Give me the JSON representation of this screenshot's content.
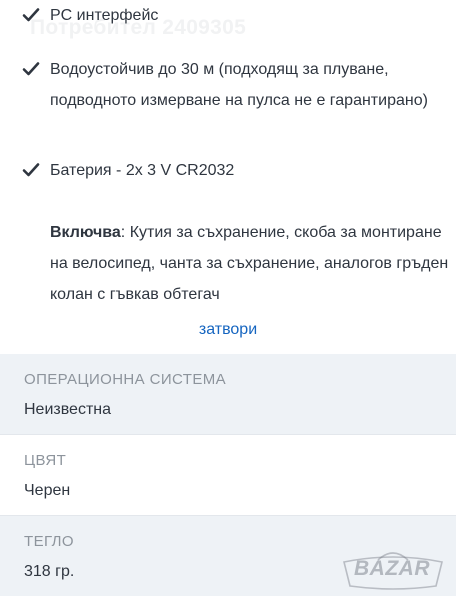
{
  "watermark": "Потребител 2409305",
  "features": [
    {
      "text": "PC интерфейс"
    },
    {
      "text": "Водоустойчив до 30 м (подходящ за плуване, подводното измерване на пулса не е гарантирано)"
    },
    {
      "text": "Батерия - 2x 3 V CR2032"
    }
  ],
  "includes": {
    "label": "Включва",
    "text": ": Кутия за съхранение, скоба за монтиране на велосипед, чанта за съхранение, аналогов гръден колан с гъвкав обтегач"
  },
  "close_link": "затвори",
  "specs": [
    {
      "label": "ОПЕРАЦИОННА СИСТЕМА",
      "value": "Неизвестна"
    },
    {
      "label": "ЦВЯТ",
      "value": "Черен"
    },
    {
      "label": "ТЕГЛО",
      "value": "318 гр."
    }
  ],
  "logo_text": "BAZAR",
  "icons": {
    "check": "check-icon",
    "logo": "bag-icon"
  },
  "colors": {
    "link": "#1565c0",
    "text": "#2f3640",
    "label": "#8d949c",
    "row_shade": "#eef2f6"
  }
}
